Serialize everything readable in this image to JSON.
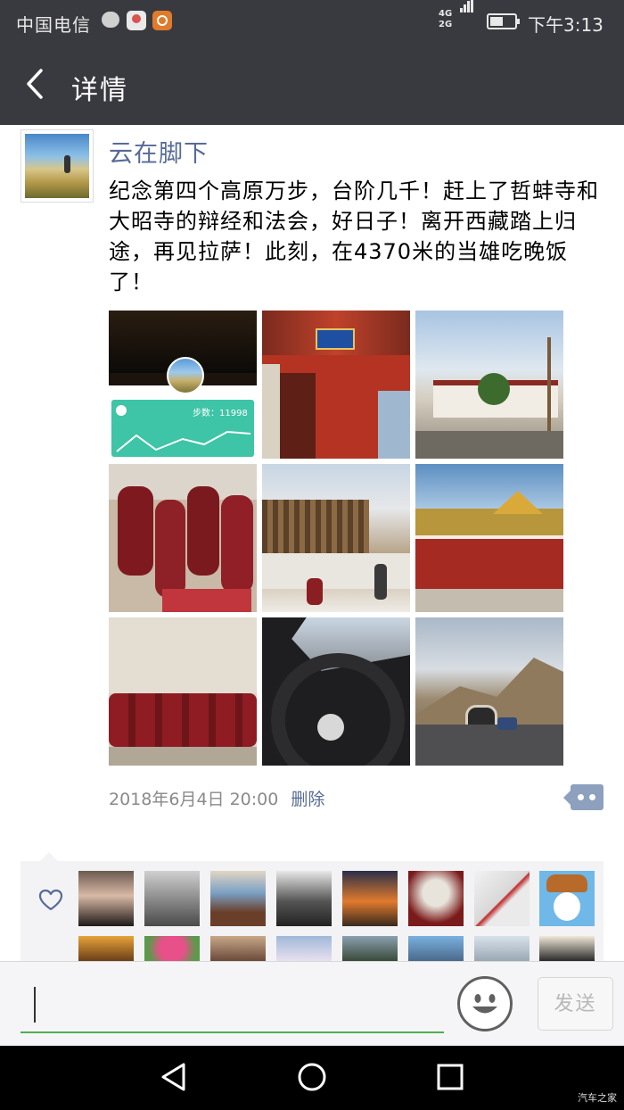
{
  "status_bar": {
    "carrier": "中国电信",
    "network": "4G 2G",
    "time": "下午3:13"
  },
  "nav": {
    "title": "详情"
  },
  "post": {
    "nickname": "云在脚下",
    "content": "纪念第四个高原万步，台阶几千！赶上了哲蚌寺和大昭寺的辩经和法会，好日子！离开西藏踏上归途，再见拉萨！此刻，在4370米的当雄吃晚饭了！",
    "steps_label": "步数：11998",
    "timestamp": "2018年6月4日 20:00",
    "delete_label": "删除"
  },
  "input": {
    "send_label": "发送"
  },
  "watermark": "汽车之家",
  "colors": {
    "header": "#393a3f",
    "link": "#576b95",
    "accent": "#4caf50"
  }
}
